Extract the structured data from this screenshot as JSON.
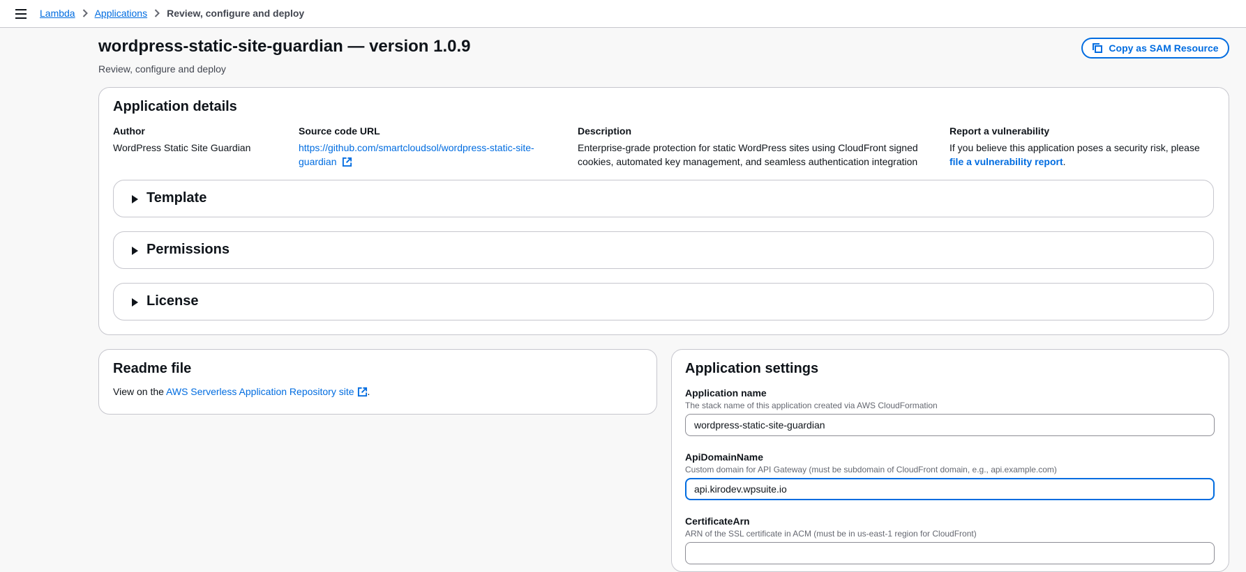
{
  "breadcrumb": {
    "items": [
      "Lambda",
      "Applications"
    ],
    "current": "Review, configure and deploy"
  },
  "header": {
    "title": "wordpress-static-site-guardian — version 1.0.9",
    "subtitle": "Review, configure and deploy",
    "copy_sam_label": "Copy as SAM Resource"
  },
  "app_details": {
    "title": "Application details",
    "author_label": "Author",
    "author_value": "WordPress Static Site Guardian",
    "source_label": "Source code URL",
    "source_value_line1": "https://github.com/smartcloudsol/wordpress-static-site-",
    "source_value_line2": "guardian",
    "description_label": "Description",
    "description_line1": "Enterprise-grade protection for static WordPress sites using CloudFront signed",
    "description_line2": "cookies, automated key management, and seamless authentication integration",
    "vuln_label": "Report a vulnerability",
    "vuln_text": "If you believe this application poses a security risk, please",
    "vuln_link": "file a vulnerability report",
    "vuln_period": "."
  },
  "sections": [
    "Template",
    "Permissions",
    "License"
  ],
  "readme": {
    "title": "Readme file",
    "prefix": "View on the ",
    "link": "AWS Serverless Application Repository site",
    "suffix": "."
  },
  "settings": {
    "title": "Application settings",
    "fields": [
      {
        "label": "Application name",
        "description": "The stack name of this application created via AWS CloudFormation",
        "value": "wordpress-static-site-guardian"
      },
      {
        "label": "ApiDomainName",
        "description": "Custom domain for API Gateway (must be subdomain of CloudFront domain, e.g., api.example.com)",
        "value": "api.kirodev.wpsuite.io"
      },
      {
        "label": "CertificateArn",
        "description": "ARN of the SSL certificate in ACM (must be in us-east-1 region for CloudFront)",
        "value": ""
      }
    ]
  },
  "colors": {
    "link": "#006ce0",
    "border": "#c6c6cd",
    "background": "#f8f8f8"
  }
}
